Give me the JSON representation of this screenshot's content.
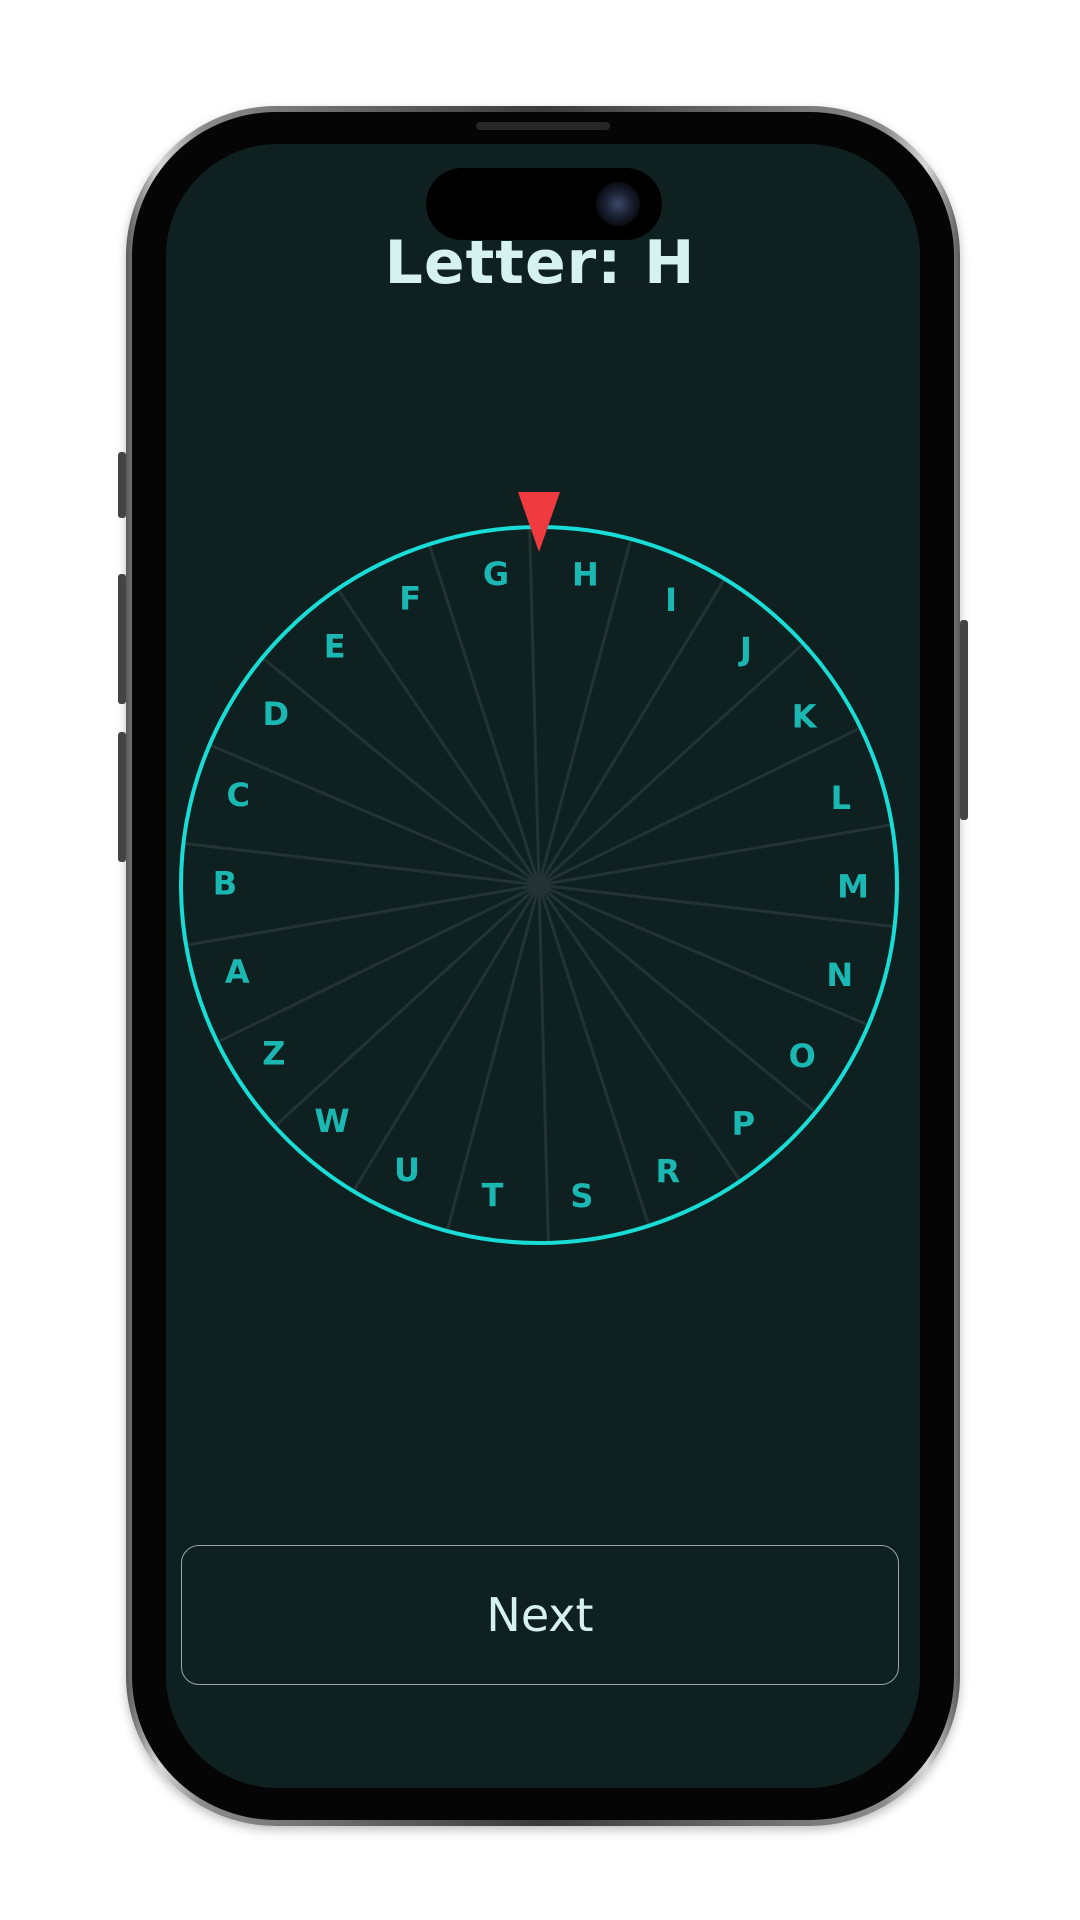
{
  "header": {
    "title": "Letter: H"
  },
  "wheel": {
    "letters": [
      "H",
      "I",
      "J",
      "K",
      "L",
      "M",
      "N",
      "O",
      "P",
      "R",
      "S",
      "T",
      "U",
      "W",
      "Z",
      "A",
      "B",
      "C",
      "D",
      "E",
      "F",
      "G"
    ],
    "selected": "H",
    "ring_color": "#19dcd6",
    "letter_color": "#1bb8b3",
    "pointer_color": "#ef3b40",
    "spoke_color": "#233333"
  },
  "footer": {
    "next_label": "Next"
  }
}
